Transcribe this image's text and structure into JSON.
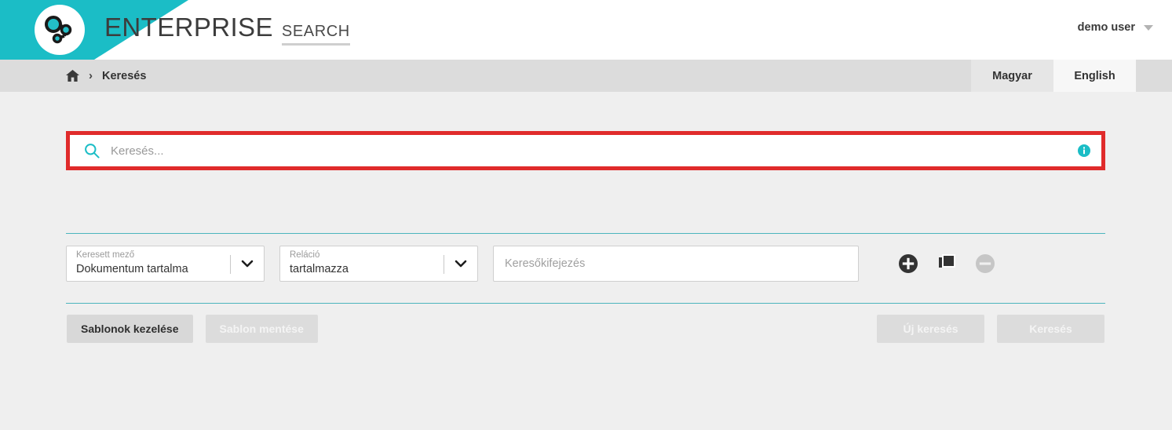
{
  "header": {
    "brand_main": "ENTERPRISE",
    "brand_sub": "SEARCH",
    "user_name": "demo user",
    "logo_icon": "network-nodes-logo",
    "caret_icon": "chevron-down-icon",
    "teal": "#1bbdc6"
  },
  "breadcrumb": {
    "home_icon": "home-icon",
    "separator": "›",
    "current": "Keresés"
  },
  "languages": [
    {
      "label": "Magyar",
      "active": false
    },
    {
      "label": "English",
      "active": true
    }
  ],
  "search": {
    "placeholder": "Keresés...",
    "value": "",
    "search_icon": "magnifier-icon",
    "info_icon": "info-circle-icon",
    "highlight_color": "#e02b2b",
    "icon_color": "#1bbdc6"
  },
  "criteria": {
    "field": {
      "label": "Keresett mező",
      "value": "Dokumentum tartalma",
      "chevron_icon": "chevron-down-icon"
    },
    "relation": {
      "label": "Reláció",
      "value": "tartalmazza",
      "chevron_icon": "chevron-down-icon"
    },
    "term": {
      "placeholder": "Keresőkifejezés",
      "value": ""
    },
    "actions": [
      {
        "name": "add-criterion",
        "icon": "plus-circle-icon",
        "enabled": true
      },
      {
        "name": "duplicate-criterion",
        "icon": "copy-icon",
        "enabled": true
      },
      {
        "name": "remove-criterion",
        "icon": "minus-circle-icon",
        "enabled": false
      }
    ]
  },
  "buttons": {
    "manage_templates": "Sablonok kezelése",
    "save_template": "Sablon mentése",
    "new_search": "Új keresés",
    "search": "Keresés"
  }
}
